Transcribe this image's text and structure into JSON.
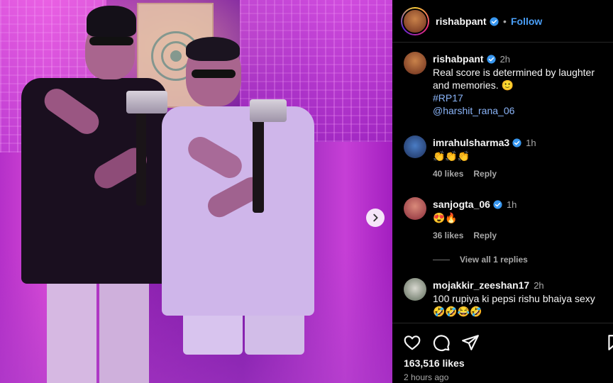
{
  "post": {
    "author": "rishabpant",
    "follow_label": "Follow",
    "separator": "•",
    "more_label": "···",
    "caption": {
      "username": "rishabpant",
      "time": "2h",
      "text": "Real score is determined by laughter and memories. 🙂",
      "hashtag": "#RP17",
      "mention": "@harshit_rana_06"
    }
  },
  "comments": [
    {
      "username": "imrahulsharma3",
      "time": "1h",
      "text": "👏👏👏",
      "likes": "40 likes",
      "reply": "Reply"
    },
    {
      "username": "sanjogta_06",
      "time": "1h",
      "text": "😍🔥",
      "likes": "36 likes",
      "reply": "Reply"
    },
    {
      "username": "mojakkir_zeeshan17",
      "time": "2h",
      "text": "100 rupiya ki pepsi rishu bhaiya sexy 🤣🤣😂🤣"
    }
  ],
  "view_replies": "View all 1 replies",
  "stats": {
    "likes": "163,516 likes",
    "posted": "2 hours ago"
  },
  "colors": {
    "accent": "#4a9ff7",
    "link": "#8ab4f8",
    "verified": "#3897f0"
  },
  "icons": [
    "verified-badge-icon",
    "chevron-right-icon",
    "heart-icon",
    "comment-icon",
    "share-icon",
    "bookmark-icon"
  ]
}
